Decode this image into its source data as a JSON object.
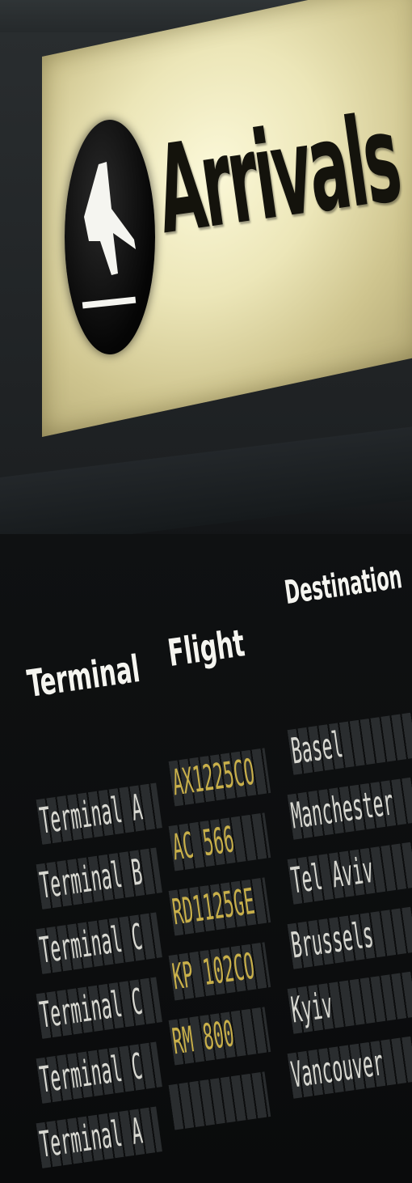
{
  "sign": {
    "title": "Arrivals",
    "icon": "plane-landing-icon",
    "color": "#f3efc6"
  },
  "board": {
    "headers": {
      "terminal": "Terminal",
      "flight": "Flight",
      "destination": "Destination"
    },
    "rows": [
      {
        "terminal": "Terminal A",
        "flight": "AX1225CO",
        "destination": "Basel"
      },
      {
        "terminal": "Terminal B",
        "flight": "AC 566",
        "destination": "Manchester"
      },
      {
        "terminal": "Terminal C",
        "flight": "RD1125GE",
        "destination": "Tel Aviv"
      },
      {
        "terminal": "Terminal C",
        "flight": "KP 102CO",
        "destination": "Brussels"
      },
      {
        "terminal": "Terminal C",
        "flight": "RM 800",
        "destination": "Kyiv"
      },
      {
        "terminal": "Terminal A",
        "flight": "",
        "destination": "Vancouver"
      }
    ],
    "flight_text_color": "#c9b04a"
  }
}
